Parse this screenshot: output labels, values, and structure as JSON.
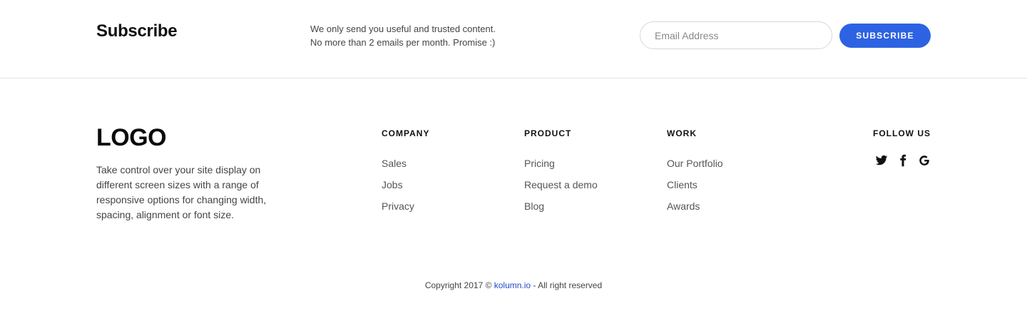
{
  "subscribe": {
    "title": "Subscribe",
    "desc_line1": "We only send you useful and trusted content.",
    "desc_line2": "No more than 2 emails per month. Promise :)",
    "email_placeholder": "Email Address",
    "email_value": "",
    "button_label": "SUBSCRIBE"
  },
  "brand": {
    "logo": "LOGO",
    "description": "Take control over your site display on different screen sizes with a range of responsive options for changing width, spacing, alignment or font size."
  },
  "columns": {
    "company": {
      "heading": "COMPANY",
      "links": [
        "Sales",
        "Jobs",
        "Privacy"
      ]
    },
    "product": {
      "heading": "PRODUCT",
      "links": [
        "Pricing",
        "Request a demo",
        "Blog"
      ]
    },
    "work": {
      "heading": "WORK",
      "links": [
        "Our Portfolio",
        "Clients",
        "Awards"
      ]
    }
  },
  "follow": {
    "heading": "FOLLOW US",
    "icons": [
      "twitter-icon",
      "facebook-icon",
      "google-icon"
    ]
  },
  "footer": {
    "copyright_prefix": "Copyright 2017 ©",
    "site_link": "kolumn.io",
    "copyright_suffix": "- All right reserved"
  },
  "colors": {
    "accent": "#2d63e2",
    "link": "#2547c7"
  }
}
